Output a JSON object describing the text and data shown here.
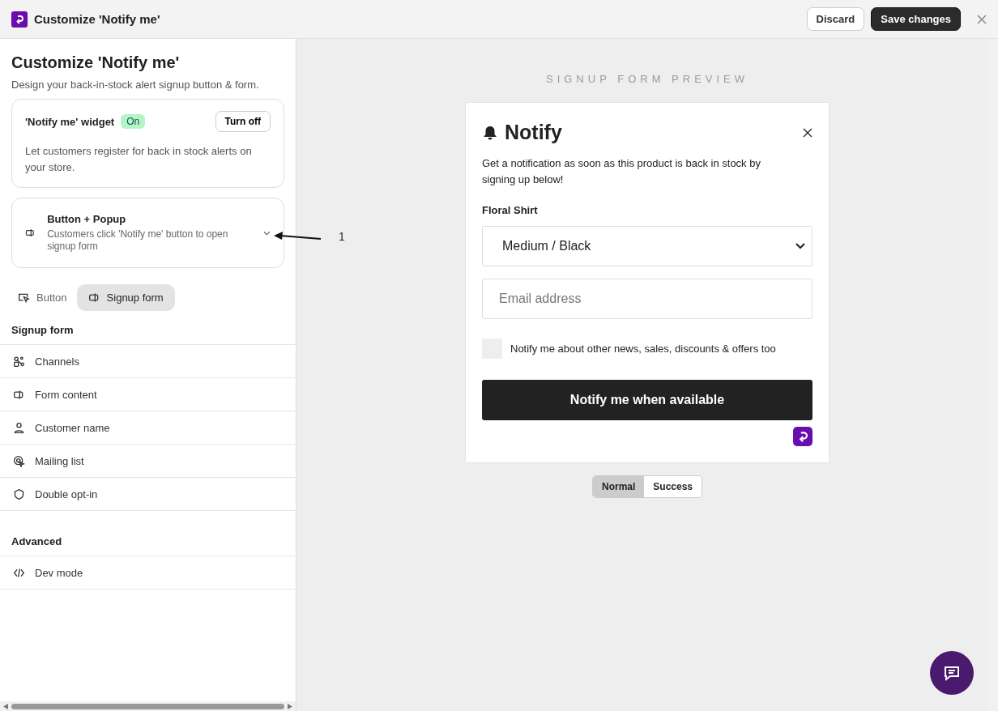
{
  "window": {
    "title": "Customize 'Notify me'",
    "buttons": [
      {
        "label": "Discard",
        "kind": "secondary"
      },
      {
        "label": "Save changes",
        "kind": "primary"
      }
    ]
  },
  "panel": {
    "heading": "Customize 'Notify me'",
    "subtitle": "Design your back-in-stock alert signup button & form.",
    "widget_card": {
      "title": "'Notify me' widget",
      "status": "On",
      "on": true,
      "button": "Turn off",
      "description": "Let customers register for back in stock alerts on your store."
    },
    "mode_card": {
      "title": "Button + Popup",
      "description": "Customers click 'Notify me' button to open signup form",
      "expanded": false
    },
    "tabs": [
      {
        "label": "Button",
        "selected": false
      },
      {
        "label": "Signup form",
        "selected": true
      }
    ],
    "sections": [
      {
        "title": "Signup form",
        "items": [
          "Channels",
          "Form content",
          "Customer name",
          "Mailing list",
          "Double opt-in"
        ]
      },
      {
        "title": "Advanced",
        "items": [
          "Dev mode"
        ]
      }
    ]
  },
  "annotation": {
    "label": "1"
  },
  "preview": {
    "caption": "SIGNUP FORM PREVIEW",
    "form": {
      "title": "Notify",
      "description": "Get a notification as soon as this product is back in stock by signing up below!",
      "product": "Floral Shirt",
      "variant": "Medium / Black",
      "email_placeholder": "Email address",
      "consent": {
        "label": "Notify me about other news, sales, discounts & offers too",
        "checked": false
      },
      "submit": "Notify me when available"
    },
    "states": [
      {
        "label": "Normal",
        "selected": true
      },
      {
        "label": "Success",
        "selected": false
      }
    ]
  }
}
